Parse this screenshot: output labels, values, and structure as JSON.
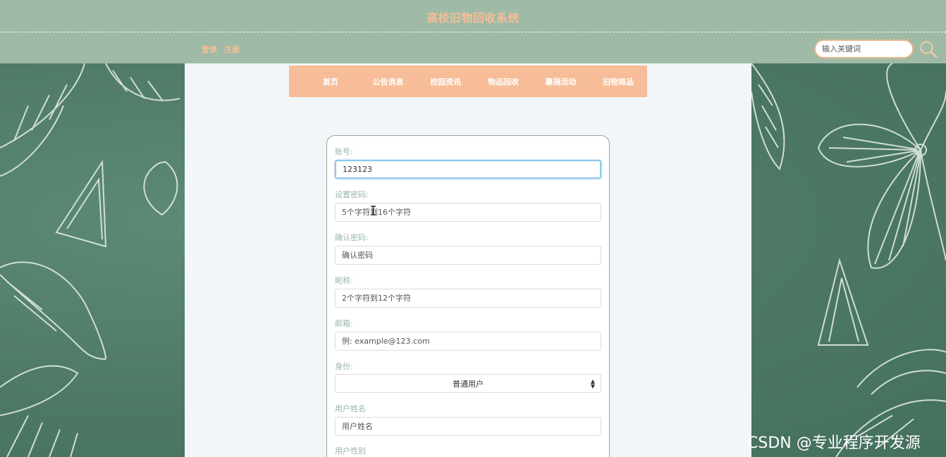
{
  "header": {
    "title": "高校旧物回收系统",
    "login": "登录",
    "register": "注册",
    "search_placeholder": "输入关键词"
  },
  "nav": {
    "items": [
      "首页",
      "公告消息",
      "校园资讯",
      "物品回收",
      "募捐活动",
      "旧物商品"
    ]
  },
  "form": {
    "account_label": "账号:",
    "account_value": "123123",
    "password_label": "设置密码:",
    "password_placeholder": "5个字符到16个字符",
    "confirm_label": "确认密码:",
    "confirm_placeholder": "确认密码",
    "nickname_label": "昵称:",
    "nickname_placeholder": "2个字符到12个字符",
    "email_label": "邮箱:",
    "email_placeholder": "例: example@123.com",
    "identity_label": "身份:",
    "identity_value": "普通用户",
    "realname_label": "用户姓名",
    "realname_placeholder": "用户姓名",
    "gender_label": "用户性别"
  },
  "watermark": "CSDN @专业程序开发源",
  "colors": {
    "header_bg": "#9fbaa6",
    "accent_orange": "#f6bd98",
    "chalkboard": "#4e7a68"
  }
}
